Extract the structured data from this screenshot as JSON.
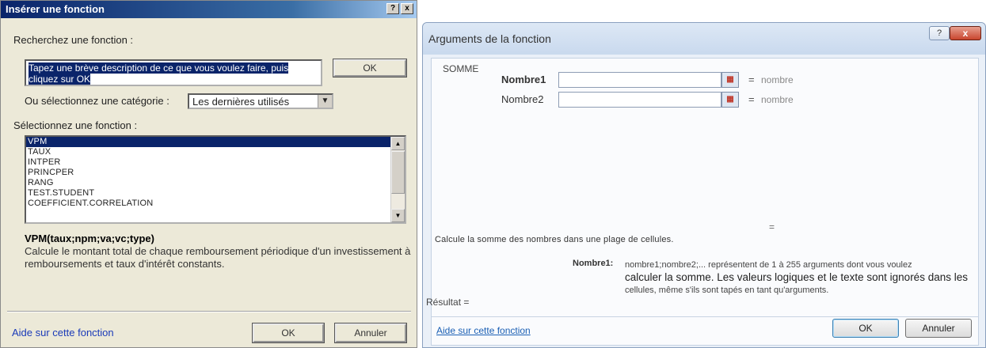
{
  "left_dialog": {
    "title": "Insérer une fonction",
    "help_btn": "?",
    "close_btn": "x",
    "search_label": "Recherchez une fonction :",
    "search_value": "Tapez une brève description de ce que vous voulez faire, puis cliquez sur OK",
    "search_ok": "OK",
    "category_label": "Ou sélectionnez une catégorie :",
    "category_value": "Les dernières utilisés",
    "function_list_label": "Sélectionnez une fonction :",
    "functions": [
      "VPM",
      "TAUX",
      "INTPER",
      "PRINCPER",
      "RANG",
      "TEST.STUDENT",
      "COEFFICIENT.CORRELATION"
    ],
    "signature": "VPM(taux;npm;va;vc;type)",
    "description": "Calcule le montant total de chaque remboursement périodique d'un investissement à remboursements et taux d'intérêt constants.",
    "help_link": "Aide sur cette fonction",
    "ok": "OK",
    "cancel": "Annuler"
  },
  "right_dialog": {
    "title": "Arguments de la fonction",
    "help_btn": "?",
    "close_btn": "x",
    "function_name": "SOMME",
    "args": [
      {
        "label": "Nombre1",
        "eq": "=",
        "value": "nombre"
      },
      {
        "label": "Nombre2",
        "eq": "=",
        "value": "nombre"
      }
    ],
    "result_eq": "=",
    "function_desc": "Calcule la somme des nombres dans une plage de cellules.",
    "arg_name": "Nombre1:",
    "arg_desc_small": "nombre1;nombre2;... représentent de 1 à 255 arguments dont vous voulez",
    "arg_desc_big": "calculer la somme. Les valeurs logiques et le texte sont ignorés dans les",
    "arg_desc_small2": "cellules, même s'ils sont tapés en tant qu'arguments.",
    "result_label": "Résultat =",
    "help_link": "Aide sur cette fonction",
    "ok": "OK",
    "cancel": "Annuler"
  }
}
